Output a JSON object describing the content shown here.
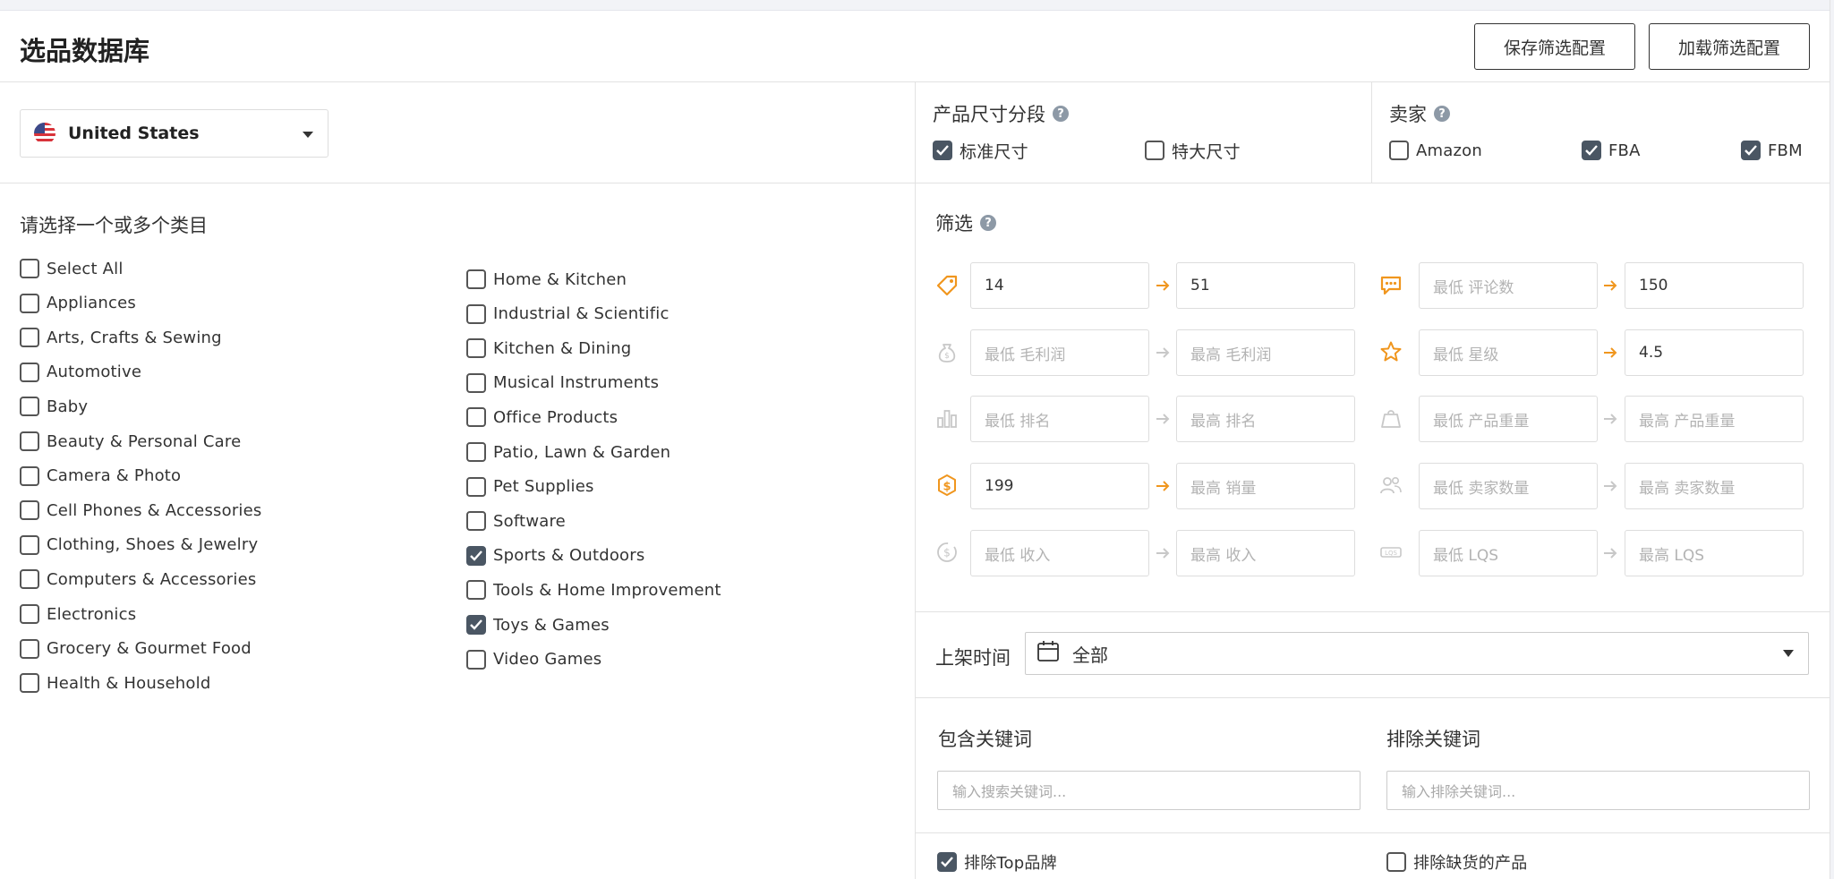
{
  "header": {
    "title": "选品数据库",
    "save_config": "保存筛选配置",
    "load_config": "加载筛选配置"
  },
  "country": {
    "selected": "United States"
  },
  "categories": {
    "title": "请选择一个或多个类目",
    "left": [
      {
        "label": "Select All",
        "checked": false
      },
      {
        "label": "Appliances",
        "checked": false
      },
      {
        "label": "Arts, Crafts & Sewing",
        "checked": false
      },
      {
        "label": "Automotive",
        "checked": false
      },
      {
        "label": "Baby",
        "checked": false
      },
      {
        "label": "Beauty & Personal Care",
        "checked": false
      },
      {
        "label": "Camera & Photo",
        "checked": false
      },
      {
        "label": "Cell Phones & Accessories",
        "checked": false
      },
      {
        "label": "Clothing, Shoes & Jewelry",
        "checked": false
      },
      {
        "label": "Computers & Accessories",
        "checked": false
      },
      {
        "label": "Electronics",
        "checked": false
      },
      {
        "label": "Grocery & Gourmet Food",
        "checked": false
      },
      {
        "label": "Health & Household",
        "checked": false
      }
    ],
    "right": [
      {
        "label": "Home & Kitchen",
        "checked": false
      },
      {
        "label": "Industrial & Scientific",
        "checked": false
      },
      {
        "label": "Kitchen & Dining",
        "checked": false
      },
      {
        "label": "Musical Instruments",
        "checked": false
      },
      {
        "label": "Office Products",
        "checked": false
      },
      {
        "label": "Patio, Lawn & Garden",
        "checked": false
      },
      {
        "label": "Pet Supplies",
        "checked": false
      },
      {
        "label": "Software",
        "checked": false
      },
      {
        "label": "Sports & Outdoors",
        "checked": true
      },
      {
        "label": "Tools & Home Improvement",
        "checked": false
      },
      {
        "label": "Toys & Games",
        "checked": true
      },
      {
        "label": "Video Games",
        "checked": false
      }
    ]
  },
  "size_tier": {
    "title": "产品尺寸分段",
    "standard": {
      "label": "标准尺寸",
      "checked": true
    },
    "oversize": {
      "label": "特大尺寸",
      "checked": false
    }
  },
  "seller": {
    "title": "卖家",
    "amazon": {
      "label": "Amazon",
      "checked": false
    },
    "fba": {
      "label": "FBA",
      "checked": true
    },
    "fbm": {
      "label": "FBM",
      "checked": true
    }
  },
  "filters": {
    "title": "筛选",
    "price": {
      "min": "14",
      "max": "51",
      "icon": "price-tag-icon",
      "active": true
    },
    "reviews": {
      "min_placeholder": "最低 评论数",
      "max": "150",
      "icon": "review-chat-icon",
      "active": true
    },
    "margin": {
      "min_placeholder": "最低 毛利润",
      "max_placeholder": "最高 毛利润",
      "icon": "money-bag-icon",
      "active": false
    },
    "rating": {
      "min_placeholder": "最低 星级",
      "max": "4.5",
      "icon": "star-icon",
      "active": true
    },
    "rank": {
      "min_placeholder": "最低 排名",
      "max_placeholder": "最高 排名",
      "icon": "bar-chart-icon",
      "active": false
    },
    "weight": {
      "min_placeholder": "最低 产品重量",
      "max_placeholder": "最高 产品重量",
      "icon": "weight-icon",
      "active": false
    },
    "sales": {
      "min": "199",
      "max_placeholder": "最高 销量",
      "icon": "dollar-icon",
      "active": true
    },
    "sellers": {
      "min_placeholder": "最低 卖家数量",
      "max_placeholder": "最高 卖家数量",
      "icon": "users-icon",
      "active": false
    },
    "revenue": {
      "min_placeholder": "最低 收入",
      "max_placeholder": "最高 收入",
      "icon": "revenue-coin-icon",
      "active": false
    },
    "lqs": {
      "min_placeholder": "最低 LQS",
      "max_placeholder": "最高 LQS",
      "icon": "lqs-icon",
      "active": false
    }
  },
  "listing_date": {
    "label": "上架时间",
    "value": "全部"
  },
  "keywords": {
    "include_label": "包含关键词",
    "include_placeholder": "输入搜索关键词...",
    "exclude_label": "排除关键词",
    "exclude_placeholder": "输入排除关键词..."
  },
  "options": {
    "exclude_top_brands": {
      "label": "排除Top品牌",
      "checked": true
    },
    "exclude_out_of_stock": {
      "label": "排除缺货的产品",
      "checked": false
    }
  },
  "colors": {
    "accent_orange": "#f0961e",
    "inactive_icon": "#c8c8c8",
    "checkbox_checked": "#4a5663"
  }
}
